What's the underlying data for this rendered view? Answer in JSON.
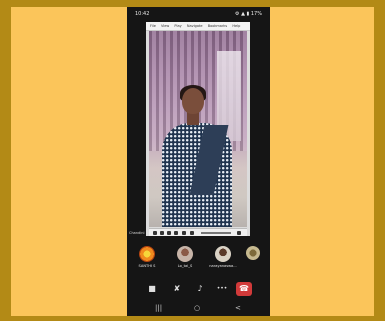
{
  "status_bar": {
    "time": "10:42",
    "right": "⚙ ▲ ▮ 17%"
  },
  "shared_screen": {
    "menu_items": [
      "File",
      "View",
      "Play",
      "Navigate",
      "Bookmarks",
      "Help"
    ],
    "sharer_label": "Chandini"
  },
  "participants": [
    {
      "name": "SANTHI S",
      "avatar_color": "#f08a1e"
    },
    {
      "name": "Lo_tai_S",
      "avatar_color": "#c7b4a8"
    },
    {
      "name": "narayanaswa...",
      "avatar_color": "#d9d2c5"
    },
    {
      "name": "",
      "avatar_color": "#c6b98f"
    }
  ],
  "call_controls": {
    "video_icon": "■",
    "mic_icon": "✘",
    "audio_icon": "♪",
    "more_icon": "•••",
    "end_icon": "☎"
  },
  "nav_bar": {
    "recents": "|||",
    "home": "○",
    "back": "<"
  },
  "colors": {
    "outer_border": "#b38a16",
    "background": "#fbc55a",
    "phone": "#151515",
    "end_call": "#d13a3a"
  }
}
